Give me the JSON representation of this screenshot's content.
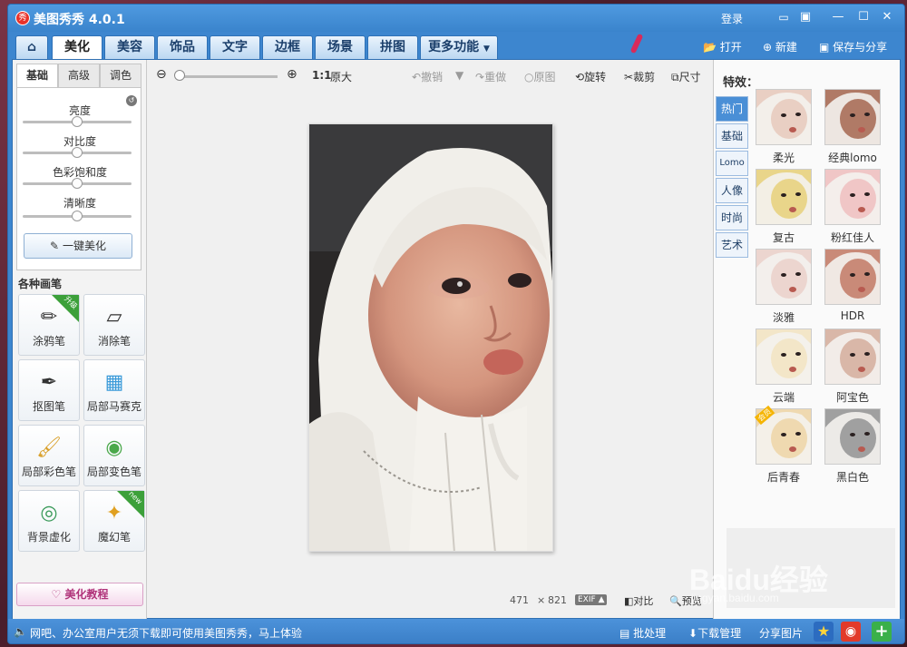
{
  "app": {
    "title": "美图秀秀 4.0.1",
    "logo_char": "秀"
  },
  "titlebar": {
    "login": "登录"
  },
  "tabs": {
    "home": "⌂",
    "items": [
      "美化",
      "美容",
      "饰品",
      "文字",
      "边框",
      "场景",
      "拼图"
    ],
    "more": "更多功能"
  },
  "topright": {
    "open": "打开",
    "new": "新建",
    "save": "保存与分享"
  },
  "left": {
    "tabs": [
      "基础",
      "高级",
      "调色"
    ],
    "sliders": [
      {
        "label": "亮度",
        "level": 0.5
      },
      {
        "label": "对比度",
        "level": 0.5
      },
      {
        "label": "色彩饱和度",
        "level": 0.5
      },
      {
        "label": "清晰度",
        "level": 0.5
      }
    ],
    "onekey": "一键美化",
    "section_title": "各种画笔",
    "brushes": [
      {
        "label": "涂鸦笔",
        "icon": "pencil-icon",
        "badge": "升级"
      },
      {
        "label": "消除笔",
        "icon": "eraser-icon",
        "badge": ""
      },
      {
        "label": "抠图笔",
        "icon": "cutout-pen-icon",
        "badge": ""
      },
      {
        "label": "局部马赛克",
        "icon": "mosaic-icon",
        "badge": ""
      },
      {
        "label": "局部彩色笔",
        "icon": "color-brush-icon",
        "badge": ""
      },
      {
        "label": "局部变色笔",
        "icon": "paint-bucket-icon",
        "badge": ""
      },
      {
        "label": "背景虚化",
        "icon": "blur-icon",
        "badge": ""
      },
      {
        "label": "魔幻笔",
        "icon": "magic-wand-icon",
        "badge": "new"
      }
    ],
    "tutorial": "美化教程"
  },
  "toolbar": {
    "zoom_ratio": "1:1",
    "original_size": "原大",
    "undo": "撤销",
    "redo": "重做",
    "original": "原图",
    "rotate": "旋转",
    "crop": "裁剪",
    "size": "尺寸"
  },
  "status": {
    "width": "471",
    "times": "×",
    "height": "821",
    "exif": "EXIF",
    "compare": "对比",
    "preview": "预览"
  },
  "right": {
    "title": "特效：",
    "categories": [
      "热门",
      "基础",
      "Lomo",
      "人像",
      "时尚",
      "艺术"
    ],
    "effects": [
      {
        "label": "柔光",
        "tone": "#e9cfc3"
      },
      {
        "label": "经典lomo",
        "tone": "#b07a66"
      },
      {
        "label": "复古",
        "tone": "#e9d58a"
      },
      {
        "label": "粉红佳人",
        "tone": "#f0c6c6"
      },
      {
        "label": "淡雅",
        "tone": "#ecd5cf"
      },
      {
        "label": "HDR",
        "tone": "#c98a78"
      },
      {
        "label": "云端",
        "tone": "#f3e6c8"
      },
      {
        "label": "阿宝色",
        "tone": "#d9b7a8"
      },
      {
        "label": "后青春",
        "tone": "#efd9b0",
        "badge": "会员"
      },
      {
        "label": "黑白色",
        "tone": "#a0a0a0"
      }
    ]
  },
  "bottom": {
    "notice": "网吧、办公室用户无须下载即可使用美图秀秀，马上体验",
    "batch": "批处理",
    "download": "下载管理",
    "share": "分享图片"
  },
  "watermark": "Baidu经验",
  "watermark_sub": "jingyan.baidu.com",
  "colors": {
    "accent": "#3d86cf",
    "tab_text": "#1b3f6b"
  }
}
